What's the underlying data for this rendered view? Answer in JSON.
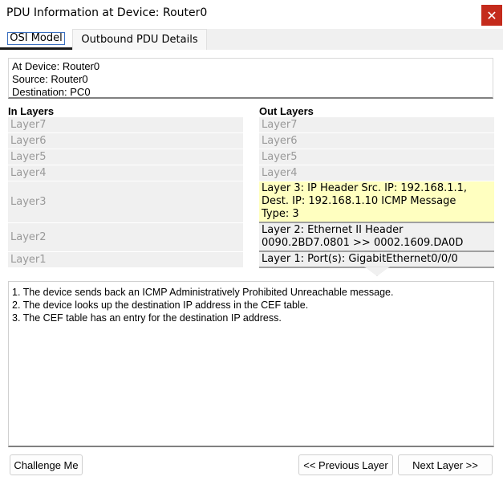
{
  "window": {
    "title": "PDU Information at Device: Router0",
    "close_glyph": "✕"
  },
  "tabs": [
    {
      "label": "OSI Model",
      "selected": true
    },
    {
      "label": "Outbound PDU Details",
      "selected": false
    }
  ],
  "info": {
    "device": "At Device: Router0",
    "source": "Source: Router0",
    "destination": "Destination: PC0"
  },
  "in_layers": {
    "header": "In Layers",
    "items": [
      "Layer7",
      "Layer6",
      "Layer5",
      "Layer4",
      "Layer3",
      "Layer2",
      "Layer1"
    ]
  },
  "out_layers": {
    "header": "Out Layers",
    "items": [
      {
        "lines": [
          "Layer7"
        ],
        "active": false
      },
      {
        "lines": [
          "Layer6"
        ],
        "active": false
      },
      {
        "lines": [
          "Layer5"
        ],
        "active": false
      },
      {
        "lines": [
          "Layer4"
        ],
        "active": false
      },
      {
        "lines": [
          "Layer 3: IP Header Src. IP: 192.168.1.1,",
          "Dest. IP: 192.168.1.10 ICMP Message",
          "Type: 3"
        ],
        "active": true,
        "highlight": "#ffffc0"
      },
      {
        "lines": [
          "Layer 2: Ethernet II Header",
          "0090.2BD7.0801 >> 0002.1609.DA0D"
        ],
        "active": true
      },
      {
        "lines": [
          "Layer 1: Port(s): GigabitEthernet0/0/0"
        ],
        "active": true
      }
    ]
  },
  "description": [
    "1. The device sends back an ICMP Administratively Prohibited Unreachable message.",
    "2. The device looks up the destination IP address in the CEF table.",
    "3. The CEF table has an entry for the destination IP address."
  ],
  "buttons": {
    "challenge": "Challenge Me",
    "previous": "<< Previous Layer",
    "next": "Next Layer >>"
  },
  "colors": {
    "close_button": "#c42b1c",
    "highlight_layer": "#ffffc0",
    "inactive_layer": "#f0f0f0"
  }
}
